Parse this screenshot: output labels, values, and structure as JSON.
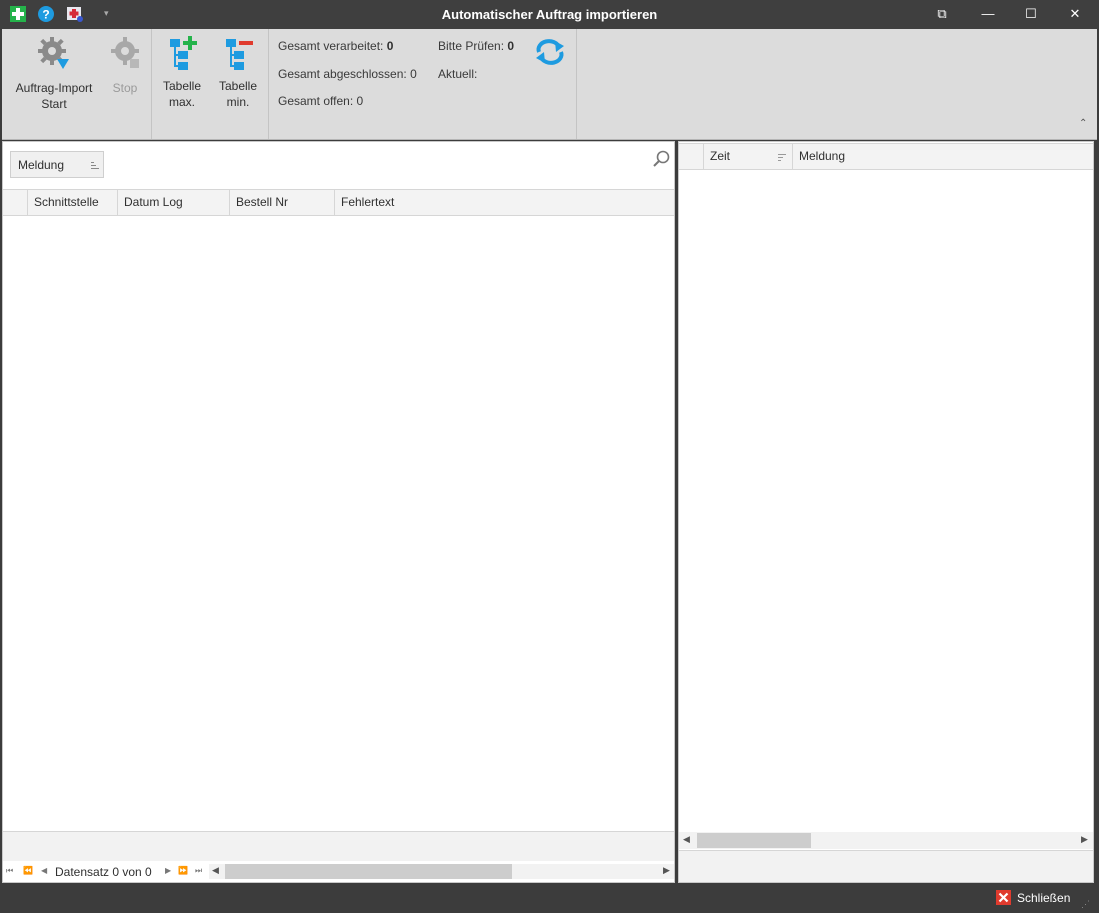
{
  "window": {
    "title": "Automatischer Auftrag importieren",
    "controls": {
      "restore_alt": "⧉",
      "minimize": "—",
      "maximize": "☐",
      "close": "✕"
    }
  },
  "ribbon": {
    "import_start_label": "Auftrag-Import Start",
    "stop_label": "Stop",
    "table_max_label": "Tabelle max.",
    "table_min_label": "Tabelle min.",
    "stats": {
      "processed_label": "Gesamt verarbeitet:",
      "processed_value": "0",
      "completed_label": "Gesamt abgeschlossen:",
      "completed_value": "0",
      "open_label": "Gesamt offen:",
      "open_value": "0",
      "check_label": "Bitte Prüfen:",
      "check_value": "0",
      "current_label": "Aktuell:"
    }
  },
  "left_grid": {
    "group_chip": "Meldung",
    "columns": [
      "Schnittstelle",
      "Datum Log",
      "Bestell Nr",
      "Fehlertext"
    ],
    "rows": [],
    "record_nav": "Datensatz 0 von 0"
  },
  "right_grid": {
    "columns": [
      "Zeit",
      "Meldung"
    ],
    "rows": []
  },
  "status": {
    "close_label": "Schließen"
  },
  "colors": {
    "titlebar": "#3f3f3f",
    "ribbon": "#dcdcdc",
    "accent_blue": "#1e9be0",
    "close_red": "#e03b2e"
  }
}
